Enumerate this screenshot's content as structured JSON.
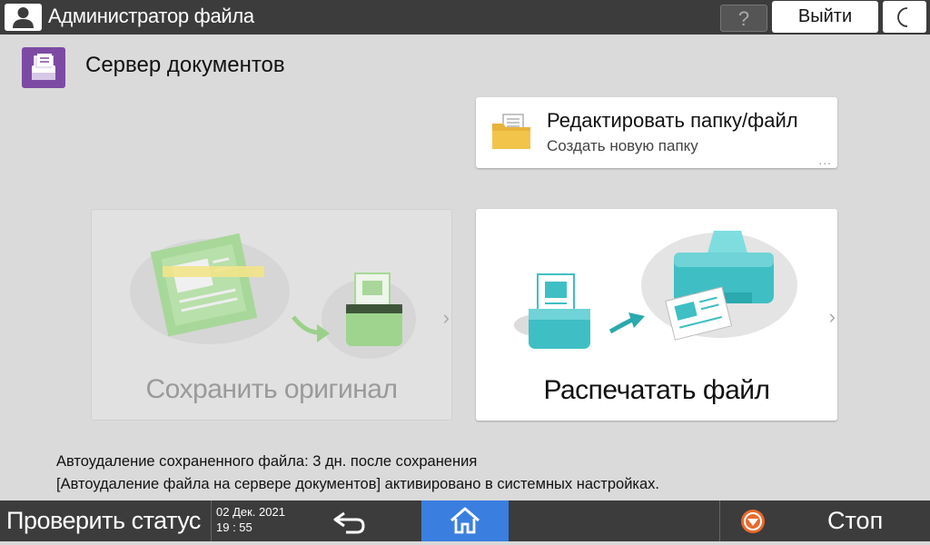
{
  "topbar": {
    "title": "Администратор файла",
    "help_label": "?",
    "logout_label": "Выйти"
  },
  "app": {
    "title": "Сервер документов"
  },
  "edit_card": {
    "title": "Редактировать папку/файл",
    "subtitle": "Создать новую папку",
    "more": "..."
  },
  "cards": {
    "save_label": "Сохранить оригинал",
    "print_label": "Распечатать файл",
    "chevron": "›"
  },
  "messages": {
    "line1": "Автоудаление сохраненного файла: 3 дн. после сохранения",
    "line2": "[Автоудаление файла на сервере документов] активировано в системных настройках."
  },
  "bottombar": {
    "status_label": "Проверить статус",
    "date": "02 Дек. 2021",
    "time": "19 : 55",
    "stop_label": "Стоп"
  },
  "icons": {
    "user": "user-icon",
    "moon": "moon-icon",
    "app": "document-server-icon",
    "folder": "folder-icon",
    "back": "back-arrow-icon",
    "home": "home-icon",
    "stop": "stop-icon"
  },
  "colors": {
    "accent_home": "#3a7ee0",
    "app_icon": "#7d4aa3",
    "teal": "#3fbfc4",
    "green_disabled": "#8fca78",
    "stop": "#e86a2c"
  }
}
